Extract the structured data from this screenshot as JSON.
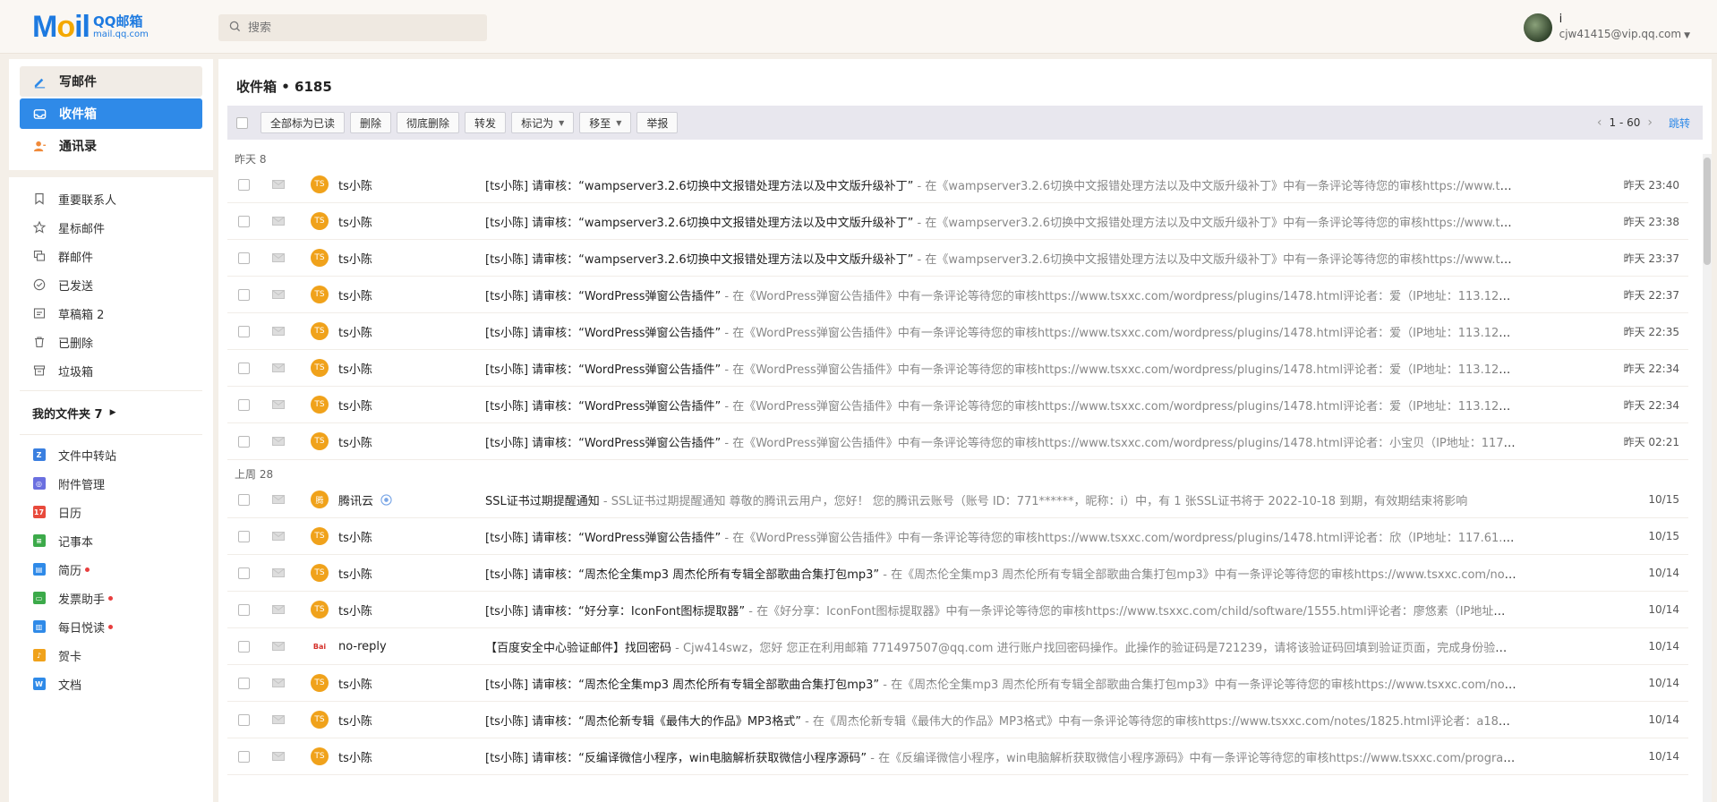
{
  "header": {
    "logo_main": "Mail",
    "logo_title": "QQ邮箱",
    "logo_domain": "mail.qq.com",
    "search_placeholder": "搜索",
    "user_name": "i",
    "user_email": "cjw41415@vip.qq.com"
  },
  "sidebar": {
    "compose": "写邮件",
    "inbox": "收件箱",
    "contacts": "通讯录",
    "items": [
      {
        "label": "重要联系人",
        "icon": "bookmark-icon"
      },
      {
        "label": "星标邮件",
        "icon": "star-icon"
      },
      {
        "label": "群邮件",
        "icon": "group-icon"
      },
      {
        "label": "已发送",
        "icon": "check-circle-icon"
      },
      {
        "label": "草稿箱 2",
        "icon": "draft-icon"
      },
      {
        "label": "已删除",
        "icon": "trash-icon"
      },
      {
        "label": "垃圾箱",
        "icon": "spam-icon"
      }
    ],
    "folders_label": "我的文件夹 7",
    "apps": [
      {
        "label": "文件中转站",
        "icon": "transfer-icon",
        "color": "#3a7fe0",
        "badge": false
      },
      {
        "label": "附件管理",
        "icon": "attachment-icon",
        "color": "#6a6fe0",
        "badge": false
      },
      {
        "label": "日历",
        "icon": "calendar-icon",
        "color": "#e84a3c",
        "badge": false
      },
      {
        "label": "记事本",
        "icon": "notebook-icon",
        "color": "#3caa4a",
        "badge": false
      },
      {
        "label": "简历",
        "icon": "resume-icon",
        "color": "#2f8ae8",
        "badge": true
      },
      {
        "label": "发票助手",
        "icon": "invoice-icon",
        "color": "#3caa4a",
        "badge": true
      },
      {
        "label": "每日悦读",
        "icon": "reading-icon",
        "color": "#2f8ae8",
        "badge": true
      },
      {
        "label": "贺卡",
        "icon": "card-icon",
        "color": "#f0a21b",
        "badge": false
      },
      {
        "label": "文档",
        "icon": "doc-icon",
        "color": "#2f8ae8",
        "badge": false
      }
    ]
  },
  "main": {
    "title": "收件箱 • 6185",
    "toolbar": {
      "mark_all_read": "全部标为已读",
      "delete": "删除",
      "delete_forever": "彻底删除",
      "forward": "转发",
      "mark_as": "标记为",
      "move_to": "移至",
      "report": "举报"
    },
    "pager": {
      "range": "1 - 60",
      "jump": "跳转"
    },
    "groups": [
      {
        "label": "昨天 8",
        "mails": [
          {
            "avatar": "TS",
            "sender": "ts小陈",
            "subject": "[ts小陈] 请审核：“wampserver3.2.6切换中文报错处理方法以及中文版升级补丁”",
            "preview": " - 在《wampserver3.2.6切换中文报错处理方法以及中文版升级补丁》中有一条评论等待您的审核https://www.tsxxc.com/not...",
            "time": "昨天 23:40"
          },
          {
            "avatar": "TS",
            "sender": "ts小陈",
            "subject": "[ts小陈] 请审核：“wampserver3.2.6切换中文报错处理方法以及中文版升级补丁”",
            "preview": " - 在《wampserver3.2.6切换中文报错处理方法以及中文版升级补丁》中有一条评论等待您的审核https://www.tsxxc.com/not...",
            "time": "昨天 23:38"
          },
          {
            "avatar": "TS",
            "sender": "ts小陈",
            "subject": "[ts小陈] 请审核：“wampserver3.2.6切换中文报错处理方法以及中文版升级补丁”",
            "preview": " - 在《wampserver3.2.6切换中文报错处理方法以及中文版升级补丁》中有一条评论等待您的审核https://www.tsxxc.com/not...",
            "time": "昨天 23:37"
          },
          {
            "avatar": "TS",
            "sender": "ts小陈",
            "subject": "[ts小陈] 请审核：“WordPress弹窗公告插件”",
            "preview": " - 在《WordPress弹窗公告插件》中有一条评论等待您的审核https://www.tsxxc.com/wordpress/plugins/1478.html评论者：爱（IP地址：113.122.219.6，113...",
            "time": "昨天 22:37"
          },
          {
            "avatar": "TS",
            "sender": "ts小陈",
            "subject": "[ts小陈] 请审核：“WordPress弹窗公告插件”",
            "preview": " - 在《WordPress弹窗公告插件》中有一条评论等待您的审核https://www.tsxxc.com/wordpress/plugins/1478.html评论者：爱（IP地址：113.122.219.6，113...",
            "time": "昨天 22:35"
          },
          {
            "avatar": "TS",
            "sender": "ts小陈",
            "subject": "[ts小陈] 请审核：“WordPress弹窗公告插件”",
            "preview": " - 在《WordPress弹窗公告插件》中有一条评论等待您的审核https://www.tsxxc.com/wordpress/plugins/1478.html评论者：爱（IP地址：113.122.219.6，113...",
            "time": "昨天 22:34"
          },
          {
            "avatar": "TS",
            "sender": "ts小陈",
            "subject": "[ts小陈] 请审核：“WordPress弹窗公告插件”",
            "preview": " - 在《WordPress弹窗公告插件》中有一条评论等待您的审核https://www.tsxxc.com/wordpress/plugins/1478.html评论者：爱（IP地址：113.122.219.6，113...",
            "time": "昨天 22:34"
          },
          {
            "avatar": "TS",
            "sender": "ts小陈",
            "subject": "[ts小陈] 请审核：“WordPress弹窗公告插件”",
            "preview": " - 在《WordPress弹窗公告插件》中有一条评论等待您的审核https://www.tsxxc.com/wordpress/plugins/1478.html评论者：小宝贝（IP地址：117.61.30.146...",
            "time": "昨天 02:21"
          }
        ]
      },
      {
        "label": "上周 28",
        "mails": [
          {
            "avatar": "腾",
            "sender": "腾讯云",
            "subject": "SSL证书过期提醒通知",
            "preview": " - SSL证书过期提醒通知 尊敬的腾讯云用户，您好！ 您的腾讯云账号（账号 ID：771******，昵称：i）中，有 1 张SSL证书将于 2022-10-18 到期，有效期结束将影响",
            "time": "10/15"
          },
          {
            "avatar": "TS",
            "sender": "ts小陈",
            "subject": "[ts小陈] 请审核：“WordPress弹窗公告插件”",
            "preview": " - 在《WordPress弹窗公告插件》中有一条评论等待您的审核https://www.tsxxc.com/wordpress/plugins/1478.html评论者：欣（IP地址：117.61.177.146，11...",
            "time": "10/15"
          },
          {
            "avatar": "TS",
            "sender": "ts小陈",
            "subject": "[ts小陈] 请审核：“周杰伦全集mp3 周杰伦所有专辑全部歌曲合集打包mp3”",
            "preview": " - 在《周杰伦全集mp3 周杰伦所有专辑全部歌曲合集打包mp3》中有一条评论等待您的审核https://www.tsxxc.com/notes/1438.h...",
            "time": "10/14"
          },
          {
            "avatar": "TS",
            "sender": "ts小陈",
            "subject": "[ts小陈] 请审核：“好分享：IconFont图标提取器”",
            "preview": " - 在《好分享：IconFont图标提取器》中有一条评论等待您的审核https://www.tsxxc.com/child/software/1555.html评论者：廖悠素（IP地址：221.216.11...",
            "time": "10/14"
          },
          {
            "avatar": "Bai",
            "sender": "no-reply",
            "subject": "【百度安全中心验证邮件】找回密码",
            "preview": " - Cjw414swz，您好 您正在利用邮箱 771497507@qq.com 进行账户找回密码操作。此操作的验证码是721239，请将该验证码回填到验证页面，完成身份验证。 欢迎您使",
            "time": "10/14"
          },
          {
            "avatar": "TS",
            "sender": "ts小陈",
            "subject": "[ts小陈] 请审核：“周杰伦全集mp3 周杰伦所有专辑全部歌曲合集打包mp3”",
            "preview": " - 在《周杰伦全集mp3 周杰伦所有专辑全部歌曲合集打包mp3》中有一条评论等待您的审核https://www.tsxxc.com/notes/1438.h...",
            "time": "10/14"
          },
          {
            "avatar": "TS",
            "sender": "ts小陈",
            "subject": "[ts小陈] 请审核：“周杰伦新专辑《最伟大的作品》MP3格式”",
            "preview": " - 在《周杰伦新专辑《最伟大的作品》MP3格式》中有一条评论等待您的审核https://www.tsxxc.com/notes/1825.html评论者：a1834997（IP...",
            "time": "10/14"
          },
          {
            "avatar": "TS",
            "sender": "ts小陈",
            "subject": "[ts小陈] 请审核：“反编译微信小程序，win电脑解析获取微信小程序源码”",
            "preview": " - 在《反编译微信小程序，win电脑解析获取微信小程序源码》中有一条评论等待您的审核https://www.tsxxc.com/program/1491.ht...",
            "time": "10/14"
          }
        ]
      }
    ]
  },
  "colors": {
    "accent": "#2f8ae8",
    "avatar_orange": "#f0a21b",
    "background": "#f4efe8"
  }
}
